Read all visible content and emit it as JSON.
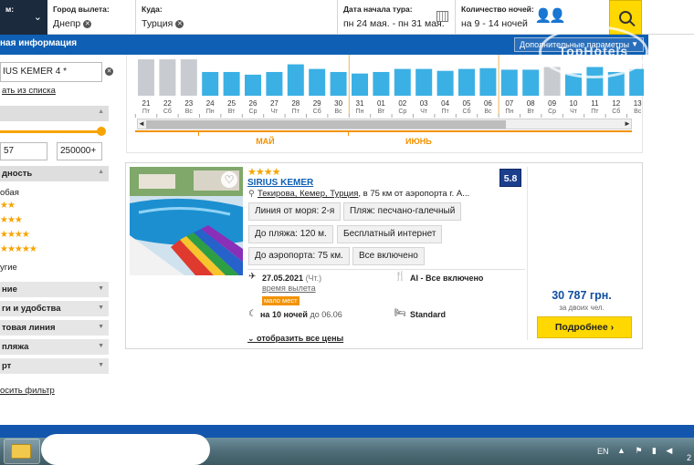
{
  "search_bar": {
    "first_label": "м:",
    "departure_label": "Город вылета:",
    "departure_value": "Днепр",
    "destination_label": "Куда:",
    "destination_value": "Турция",
    "dates_label": "Дата начала тура:",
    "dates_value": "пн 24 мая. - пн 31 мая.",
    "nights_label": "Количество ночей:",
    "nights_value": "на 9 - 14 ночей",
    "search_icon": "search-icon"
  },
  "bluebar": {
    "title": "ная информация",
    "extra_params": "Дополнительные параметры"
  },
  "watermark": "TopHotels",
  "sidebar": {
    "hotel_input": "IUS KEMER 4 *",
    "choose_from_list": "ать из списка",
    "price_min": "57",
    "price_max": "250000+",
    "stars_heading": "дность",
    "any_label": "обая",
    "stars": [
      "★★",
      "★★★",
      "★★★★",
      "★★★★★"
    ],
    "other_label": "угие",
    "sections": [
      "ние",
      "ги и удобства",
      "товая линия",
      "пляжа",
      "рт"
    ],
    "reset": "осить фильтр"
  },
  "chart_data": {
    "type": "bar",
    "categories": [
      {
        "day": "21",
        "dow": "Пт"
      },
      {
        "day": "22",
        "dow": "Сб"
      },
      {
        "day": "23",
        "dow": "Вс"
      },
      {
        "day": "24",
        "dow": "Пн"
      },
      {
        "day": "25",
        "dow": "Вт"
      },
      {
        "day": "26",
        "dow": "Ср"
      },
      {
        "day": "27",
        "dow": "Чт"
      },
      {
        "day": "28",
        "dow": "Пт"
      },
      {
        "day": "29",
        "dow": "Сб"
      },
      {
        "day": "30",
        "dow": "Вс"
      },
      {
        "day": "31",
        "dow": "Пн"
      },
      {
        "day": "01",
        "dow": "Вт"
      },
      {
        "day": "02",
        "dow": "Ср"
      },
      {
        "day": "03",
        "dow": "Чт"
      },
      {
        "day": "04",
        "dow": "Пт"
      },
      {
        "day": "05",
        "dow": "Сб"
      },
      {
        "day": "06",
        "dow": "Вс"
      },
      {
        "day": "07",
        "dow": "Пн"
      },
      {
        "day": "08",
        "dow": "Вт"
      },
      {
        "day": "09",
        "dow": "Ср"
      },
      {
        "day": "10",
        "dow": "Чт"
      },
      {
        "day": "11",
        "dow": "Пт"
      },
      {
        "day": "12",
        "dow": "Сб"
      },
      {
        "day": "13",
        "dow": "Вс"
      }
    ],
    "values": [
      95,
      95,
      95,
      62,
      62,
      55,
      62,
      82,
      70,
      62,
      58,
      62,
      70,
      70,
      65,
      70,
      72,
      68,
      68,
      75,
      58,
      75,
      62,
      70
    ],
    "inactive": [
      true,
      true,
      true,
      false,
      false,
      false,
      false,
      false,
      false,
      false,
      false,
      false,
      false,
      false,
      false,
      false,
      false,
      false,
      false,
      true,
      false,
      false,
      false,
      false
    ],
    "week_separators_after": [
      9,
      16
    ],
    "months": [
      {
        "label": "МАЙ",
        "start": 3
      },
      {
        "label": "ИЮНЬ",
        "start": 10
      }
    ],
    "ylim": [
      0,
      100
    ],
    "colors": {
      "active": "#3bb0e4",
      "inactive": "#c8ccd1",
      "accent": "#f39200"
    }
  },
  "hotel_card": {
    "stars": "★★★★",
    "name": "SIRIUS KEMER",
    "location_link": "Текирова, Кемер, Турция",
    "location_rest": ", в 75 км от аэропорта г. А...",
    "rating": "5.8",
    "tags": [
      "Линия от моря: 2-я",
      "Пляж: песчано-галечный",
      "До пляжа: 120 м.",
      "Бесплатный интернет",
      "До аэропорта: 75 км.",
      "Все включено"
    ],
    "departure_date": "27.05.2021",
    "departure_dow": "(Чт.)",
    "departure_label": "время вылета",
    "few_places": "мало мест",
    "nights": "на 10 ночей",
    "nights_till": "до 06.06",
    "meal": "AI - Все включено",
    "room": "Standard",
    "show_all_prices": "отобразить все цены",
    "price": "30 787 грн.",
    "price_sub": "за двоих чел.",
    "more_button": "Подробнее ›"
  },
  "taskbar": {
    "lang": "EN",
    "time": "2"
  }
}
